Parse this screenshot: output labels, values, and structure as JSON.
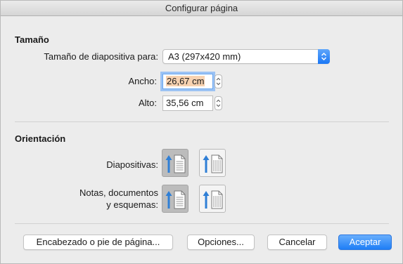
{
  "window": {
    "title": "Configurar página"
  },
  "size_section": {
    "heading": "Tamaño",
    "slide_size_label": "Tamaño de diapositiva para:",
    "slide_size_value": "A3 (297x420 mm)",
    "width_label": "Ancho:",
    "width_value": "26,67 cm",
    "height_label": "Alto:",
    "height_value": "35,56 cm"
  },
  "orientation_section": {
    "heading": "Orientación",
    "slides_label": "Diapositivas:",
    "notes_label_line1": "Notas, documentos",
    "notes_label_line2": "y esquemas:",
    "slides_selected": "portrait",
    "notes_selected": "portrait"
  },
  "buttons": {
    "header_footer": "Encabezado o pie de página...",
    "options": "Opciones...",
    "cancel": "Cancelar",
    "accept": "Aceptar"
  },
  "colors": {
    "accent": "#1e7ef6",
    "arrow": "#2f7fd6",
    "selection_highlight": "#f7d2b1",
    "focus_ring": "#9cc3f4"
  }
}
